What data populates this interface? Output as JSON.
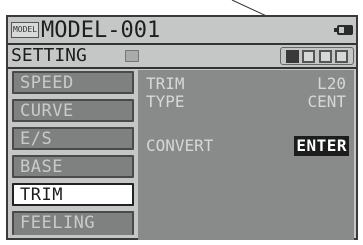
{
  "header": {
    "model_badge": "MODEL",
    "model_name": "MODEL-001"
  },
  "setting": {
    "label": "SETTING",
    "page_count": 4,
    "active_page": 1
  },
  "menu": {
    "items": [
      {
        "label": "SPEED",
        "selected": false
      },
      {
        "label": "CURVE",
        "selected": false
      },
      {
        "label": "E/S",
        "selected": false
      },
      {
        "label": "BASE",
        "selected": false
      },
      {
        "label": "TRIM",
        "selected": true
      },
      {
        "label": "FEELING",
        "selected": false
      }
    ]
  },
  "panel": {
    "trim_label": "TRIM",
    "trim_value": "L20",
    "type_label": "TYPE",
    "type_value": "CENT",
    "convert_label": "CONVERT",
    "convert_button": "ENTER"
  },
  "colors": {
    "lcd_background": "#c5c7c6",
    "menu_item": "#7f8180",
    "panel": "#898b8a",
    "selected_item": "#ffffff"
  }
}
